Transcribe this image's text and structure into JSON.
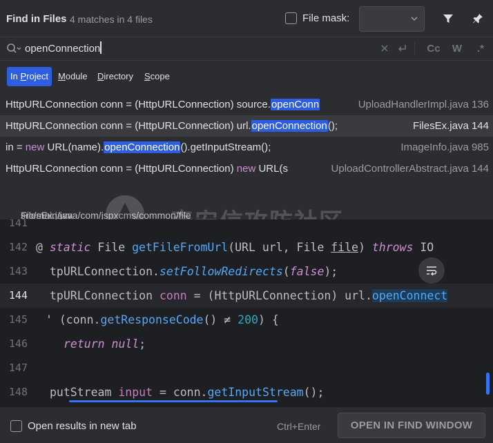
{
  "header": {
    "title": "Find in Files",
    "subtitle": "4 matches in 4 files",
    "file_mask_label": "File mask:",
    "file_mask_value": ""
  },
  "search": {
    "query": "openConnection",
    "tools": [
      "Cc",
      "W",
      ".*"
    ]
  },
  "scopes": [
    {
      "label": "In Project",
      "active": true
    },
    {
      "label": "Module",
      "active": false
    },
    {
      "label": "Directory",
      "active": false
    },
    {
      "label": "Scope",
      "active": false
    }
  ],
  "results": [
    {
      "pre": "HttpURLConnection conn = (HttpURLConnection) source.",
      "kw": "",
      "match": "openConn",
      "post": "",
      "file": "UploadHandlerImpl.java 136"
    },
    {
      "pre": "HttpURLConnection conn = (HttpURLConnection) url.",
      "kw": "",
      "match": "openConnection",
      "post": "();",
      "file": "FilesEx.java 144"
    },
    {
      "pre": "in = ",
      "kw": "new",
      "mid": " URL(name).",
      "match": "openConnection",
      "post": "().getInputStream();",
      "file": "ImageInfo.java 985"
    },
    {
      "pre": "HttpURLConnection conn = (HttpURLConnection) ",
      "kw": "new",
      "mid": " URL(s",
      "match": "",
      "post": "",
      "file": "UploadControllerAbstract.java 144"
    }
  ],
  "preview": {
    "file": "FilesEx.java",
    "path": "src/main/java/com/jspxcms/common/file",
    "watermark": "奇安信攻防社区",
    "lines": [
      {
        "num": "141"
      },
      {
        "num": "142"
      },
      {
        "num": "143"
      },
      {
        "num": "144"
      },
      {
        "num": "145"
      },
      {
        "num": "146"
      },
      {
        "num": "147"
      },
      {
        "num": "148"
      }
    ]
  },
  "footer": {
    "checkbox_label": "Open results in new tab",
    "shortcut": "Ctrl+Enter",
    "button": "OPEN IN FIND WINDOW"
  },
  "colors": {
    "accent": "#2e5ee0",
    "background": "#2b2d30",
    "editor": "#1e1f22"
  }
}
